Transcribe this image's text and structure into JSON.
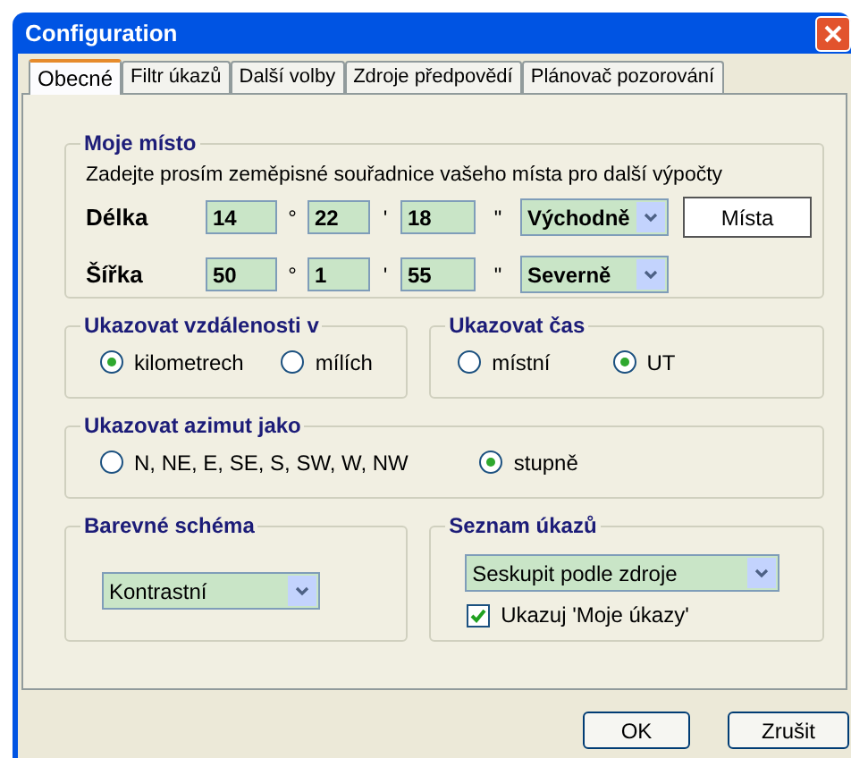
{
  "window": {
    "title": "Configuration"
  },
  "tabs": [
    {
      "label": "Obecné",
      "selected": true
    },
    {
      "label": "Filtr úkazů",
      "selected": false
    },
    {
      "label": "Další volby",
      "selected": false
    },
    {
      "label": "Zdroje předpovědí",
      "selected": false
    },
    {
      "label": "Plánovač pozorování",
      "selected": false
    }
  ],
  "location": {
    "title": "Moje místo",
    "hint": "Zadejte prosím zeměpisné souřadnice vašeho místa pro další výpočty",
    "rows": [
      {
        "label": "Délka",
        "deg": "14",
        "deg_sign": "°",
        "min": "22",
        "min_sign": "'",
        "sec": "18",
        "sec_sign": "\"",
        "direction": "Východně"
      },
      {
        "label": "Šířka",
        "deg": "50",
        "deg_sign": "°",
        "min": "1",
        "min_sign": "'",
        "sec": "55",
        "sec_sign": "\"",
        "direction": "Severně"
      }
    ],
    "places_button": "Místa"
  },
  "distance": {
    "title": "Ukazovat vzdálenosti v",
    "options": [
      {
        "label": "kilometrech",
        "selected": true
      },
      {
        "label": "mílích",
        "selected": false
      }
    ]
  },
  "time": {
    "title": "Ukazovat čas",
    "options": [
      {
        "label": "místní",
        "selected": false
      },
      {
        "label": "UT",
        "selected": true
      }
    ]
  },
  "azimuth": {
    "title": "Ukazovat azimut jako",
    "options": [
      {
        "label": "N, NE, E, SE, S, SW, W, NW",
        "selected": false
      },
      {
        "label": "stupně",
        "selected": true
      }
    ]
  },
  "color_scheme": {
    "title": "Barevné schéma",
    "value": "Kontrastní"
  },
  "event_list": {
    "title": "Seznam úkazů",
    "value": "Seskupit podle zdroje",
    "checkbox": {
      "label": "Ukazuj 'Moje úkazy'",
      "checked": true
    }
  },
  "buttons": [
    "OK",
    "Zrušit"
  ]
}
